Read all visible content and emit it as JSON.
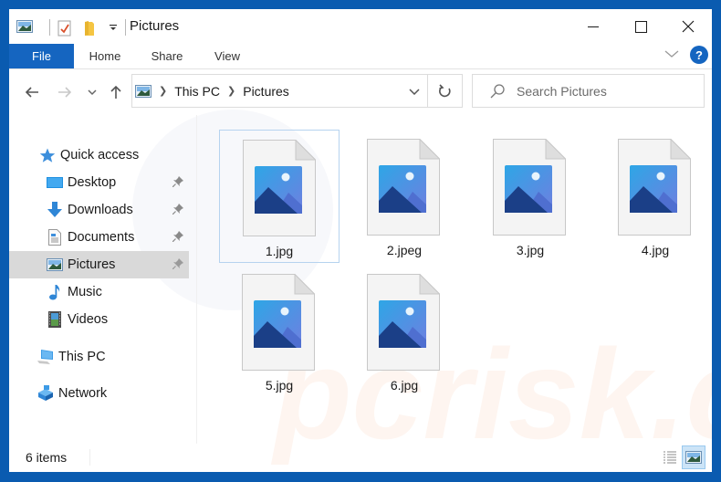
{
  "window": {
    "title": "Pictures",
    "controls": {
      "minimize": "minimize",
      "maximize": "maximize",
      "close": "close"
    }
  },
  "quick_access_toolbar": {
    "icons": [
      "pictures-folder-icon",
      "properties-icon",
      "new-folder-icon",
      "customize-dropdown-icon"
    ]
  },
  "ribbon": {
    "tabs": [
      {
        "label": "File",
        "active": true
      },
      {
        "label": "Home"
      },
      {
        "label": "Share"
      },
      {
        "label": "View"
      }
    ],
    "expand_icon": "chevron-down-icon",
    "help_label": "?"
  },
  "navigation": {
    "back_icon": "arrow-left-icon",
    "forward_icon": "arrow-right-icon",
    "recent_icon": "chevron-down-icon",
    "up_icon": "arrow-up-icon",
    "breadcrumb": [
      "This PC",
      "Pictures"
    ],
    "refresh_icon": "refresh-icon",
    "search": {
      "placeholder": "Search Pictures",
      "value": ""
    }
  },
  "sidebar": {
    "items": [
      {
        "label": "Quick access",
        "icon": "star-icon",
        "pinned": false,
        "selected": false
      },
      {
        "label": "Desktop",
        "icon": "desktop-icon",
        "pinned": true,
        "selected": false
      },
      {
        "label": "Downloads",
        "icon": "download-icon",
        "pinned": true,
        "selected": false
      },
      {
        "label": "Documents",
        "icon": "documents-icon",
        "pinned": true,
        "selected": false
      },
      {
        "label": "Pictures",
        "icon": "pictures-icon",
        "pinned": true,
        "selected": true
      },
      {
        "label": "Music",
        "icon": "music-icon",
        "pinned": false,
        "selected": false
      },
      {
        "label": "Videos",
        "icon": "videos-icon",
        "pinned": false,
        "selected": false
      },
      {
        "label": "This PC",
        "icon": "computer-icon",
        "pinned": false,
        "selected": false
      },
      {
        "label": "Network",
        "icon": "network-icon",
        "pinned": false,
        "selected": false
      }
    ]
  },
  "files": [
    {
      "name": "1.jpg",
      "selected": true
    },
    {
      "name": "2.jpeg",
      "selected": false
    },
    {
      "name": "3.jpg",
      "selected": false
    },
    {
      "name": "4.jpg",
      "selected": false
    },
    {
      "name": "5.jpg",
      "selected": false
    },
    {
      "name": "6.jpg",
      "selected": false
    }
  ],
  "status": {
    "item_count": "6 items",
    "views": [
      {
        "name": "details-view",
        "active": false
      },
      {
        "name": "large-icons-view",
        "active": true
      }
    ]
  },
  "watermark": "pcrisk.com",
  "colors": {
    "accent": "#1565c0",
    "frame": "#0a5bb0",
    "selected_nav": "#d9d9d9",
    "selected_item_border": "#b6d3ef",
    "active_view_bg": "#cce4f7"
  }
}
